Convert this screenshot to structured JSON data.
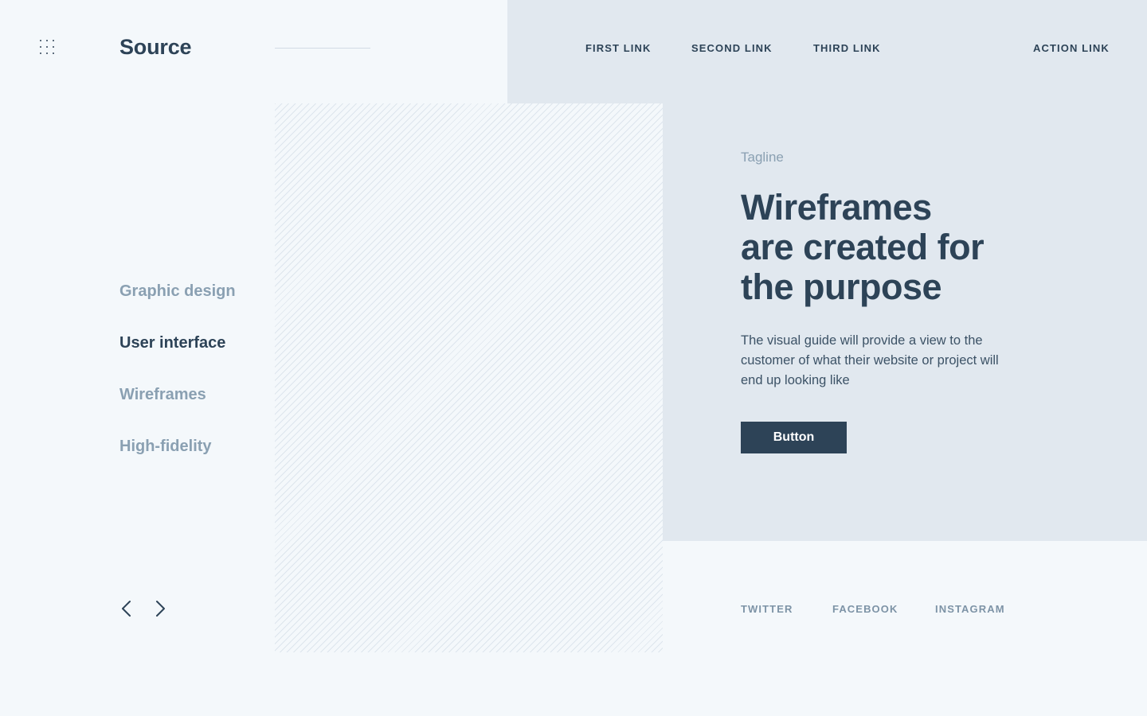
{
  "header": {
    "logo": "Source",
    "nav": [
      "FIRST LINK",
      "SECOND LINK",
      "THIRD LINK"
    ],
    "action_link": "ACTION LINK",
    "menu_icon": "grid-dots-icon"
  },
  "sidebar": {
    "items": [
      {
        "label": "Graphic design",
        "active": false
      },
      {
        "label": "User interface",
        "active": true
      },
      {
        "label": "Wireframes",
        "active": false
      },
      {
        "label": "High-fidelity",
        "active": false
      }
    ],
    "prev_icon": "chevron-left-icon",
    "next_icon": "chevron-right-icon"
  },
  "hero": {
    "tagline": "Tagline",
    "headline_lines": [
      "Wireframes",
      "are created for",
      "the purpose"
    ],
    "body": "The visual guide will provide a view to the customer of what their website or project will end up looking like",
    "button_label": "Button"
  },
  "social": [
    "TWITTER",
    "FACEBOOK",
    "INSTAGRAM"
  ],
  "colors": {
    "background": "#f4f8fb",
    "panel": "#e1e8ef",
    "primary": "#2d4357",
    "muted": "#8aa0b2"
  }
}
